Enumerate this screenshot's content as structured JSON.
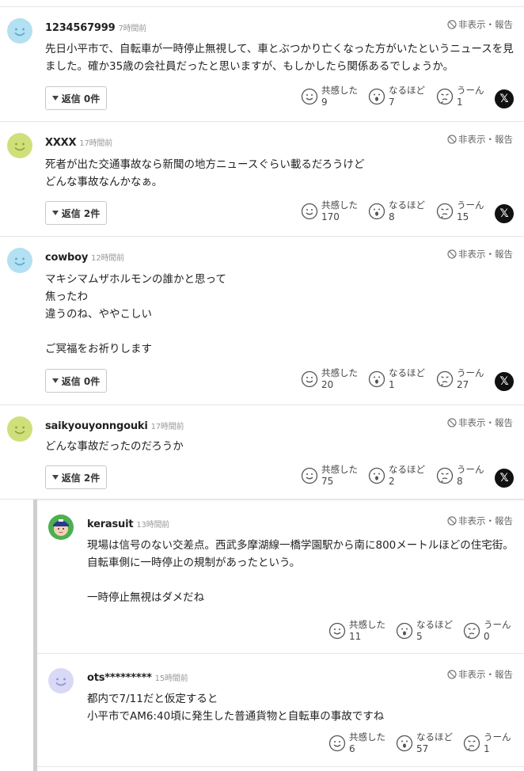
{
  "ui": {
    "hide_report": "非表示・報告",
    "react_empathy": "共感した",
    "react_naruhodo": "なるほど",
    "react_uun": "うーん",
    "x_share": "𝕏"
  },
  "colors": {
    "avatar_blue": "#b3e0f2",
    "avatar_green": "#cfe07a",
    "avatar_purple": "#d7d9f5",
    "reply_bar": "#cfcfcf"
  },
  "comments": [
    {
      "user": "1234567999",
      "ago": "7時間前",
      "body": "先日小平市で、自転車が一時停止無視して、車とぶつかり亡くなった方がいたというニュースを見ました。確か35歳の会社員だったと思いますが、もしかしたら関係あるでしょうか。",
      "reply_label": "返信 0件",
      "empathy": "9",
      "naruhodo": "7",
      "uun": "1"
    },
    {
      "user": "XXXX",
      "ago": "17時間前",
      "body": "死者が出た交通事故なら新聞の地方ニュースぐらい載るだろうけど\nどんな事故なんかなぁ。",
      "reply_label": "返信 2件",
      "empathy": "170",
      "naruhodo": "8",
      "uun": "15"
    },
    {
      "user": "cowboy",
      "ago": "12時間前",
      "body": "マキシマムザホルモンの誰かと思って\n焦ったわ\n違うのね、ややこしい\n\nご冥福をお祈りします",
      "reply_label": "返信 0件",
      "empathy": "20",
      "naruhodo": "1",
      "uun": "27"
    },
    {
      "user": "saikyouyonngouki",
      "ago": "17時間前",
      "body": "どんな事故だったのだろうか",
      "reply_label": "返信 2件",
      "empathy": "75",
      "naruhodo": "2",
      "uun": "8"
    }
  ],
  "replies": [
    {
      "user": "kerasuit",
      "ago": "13時間前",
      "body": "現場は信号のない交差点。西武多摩湖線一橋学園駅から南に800メートルほどの住宅街。自転車側に一時停止の規制があったという。\n\n一時停止無視はダメだね",
      "empathy": "11",
      "naruhodo": "5",
      "uun": "0"
    },
    {
      "user": "ots*********",
      "ago": "15時間前",
      "body": "都内で7/11だと仮定すると\n小平市でAM6:40頃に発生した普通貨物と自転車の事故ですね",
      "empathy": "6",
      "naruhodo": "57",
      "uun": "1"
    }
  ]
}
